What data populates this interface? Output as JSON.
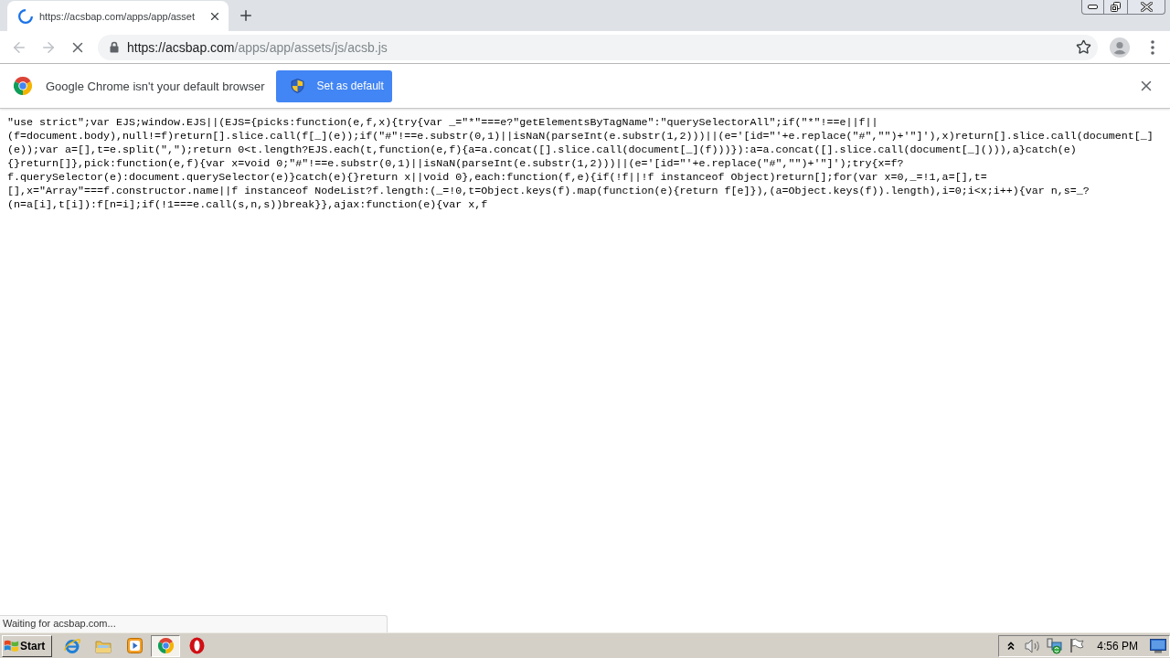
{
  "window": {
    "controls": [
      {
        "kind": "minimize"
      },
      {
        "kind": "restore"
      },
      {
        "kind": "close"
      }
    ]
  },
  "tabs": [
    {
      "title": "https://acsbap.com/apps/app/asset",
      "selected": true,
      "loading": true
    }
  ],
  "toolbar": {
    "nav_buttons": [
      {
        "kind": "back",
        "disabled": true
      },
      {
        "kind": "forward",
        "disabled": true
      },
      {
        "kind": "stop",
        "disabled": false
      }
    ],
    "address": {
      "host": "https://acsbap.com",
      "path": "/apps/app/assets/js/acsb.js"
    },
    "bookmarked": false
  },
  "infobar": {
    "message": "Google Chrome isn't your default browser",
    "button": "Set as default"
  },
  "code": {
    "lines": [
      "\"use strict\";var EJS;window.EJS||(EJS={picks:function(e,f,x){try{var _=\"*\"===e?\"getElementsByTagName\":\"querySelectorAll\";if(\"*\"!==e||f||",
      "(f=document.body),null!=f)return[].slice.call(f[_](e));if(\"#\"!==e.substr(0,1)||isNaN(parseInt(e.substr(1,2)))||(e='[id=\"'+e.replace(\"#\",\"\")+'\"]'),x)return[].slice.call(document[_]",
      "(e));var a=[],t=e.split(\",\");return 0<t.length?EJS.each(t,function(e,f){a=a.concat([].slice.call(document[_](f)))}):a=a.concat([].slice.call(document[_]())),a}catch(e)",
      "{}return[]},pick:function(e,f){var x=void 0;\"#\"!==e.substr(0,1)||isNaN(parseInt(e.substr(1,2)))||(e='[id=\"'+e.replace(\"#\",\"\")+'\"]');try{x=f?",
      "f.querySelector(e):document.querySelector(e)}catch(e){}return x||void 0},each:function(f,e){if(!f||!f instanceof Object)return[];for(var x=0,_=!1,a=[],t=",
      "[],x=\"Array\"===f.constructor.name||f instanceof NodeList?f.length:(_=!0,t=Object.keys(f).map(function(e){return f[e]}),(a=Object.keys(f)).length),i=0;i<x;i++){var n,s=_?",
      "(n=a[i],t[i]):f[n=i];if(!1===e.call(s,n,s))break}},ajax:function(e){var x,f"
    ]
  },
  "status_bubble": "Waiting for acsbap.com...",
  "taskbar": {
    "start": "Start",
    "apps": [
      {
        "kind": "e_logo",
        "selected": false
      },
      {
        "kind": "folder",
        "selected": false
      },
      {
        "kind": "player",
        "selected": false
      },
      {
        "kind": "round_logo",
        "selected": true
      },
      {
        "kind": "o_logo",
        "selected": false
      }
    ],
    "tray": [
      {
        "kind": "chevrons"
      },
      {
        "kind": "speaker"
      },
      {
        "kind": "network"
      },
      {
        "kind": "flag"
      }
    ],
    "clock": "4:56 PM"
  }
}
